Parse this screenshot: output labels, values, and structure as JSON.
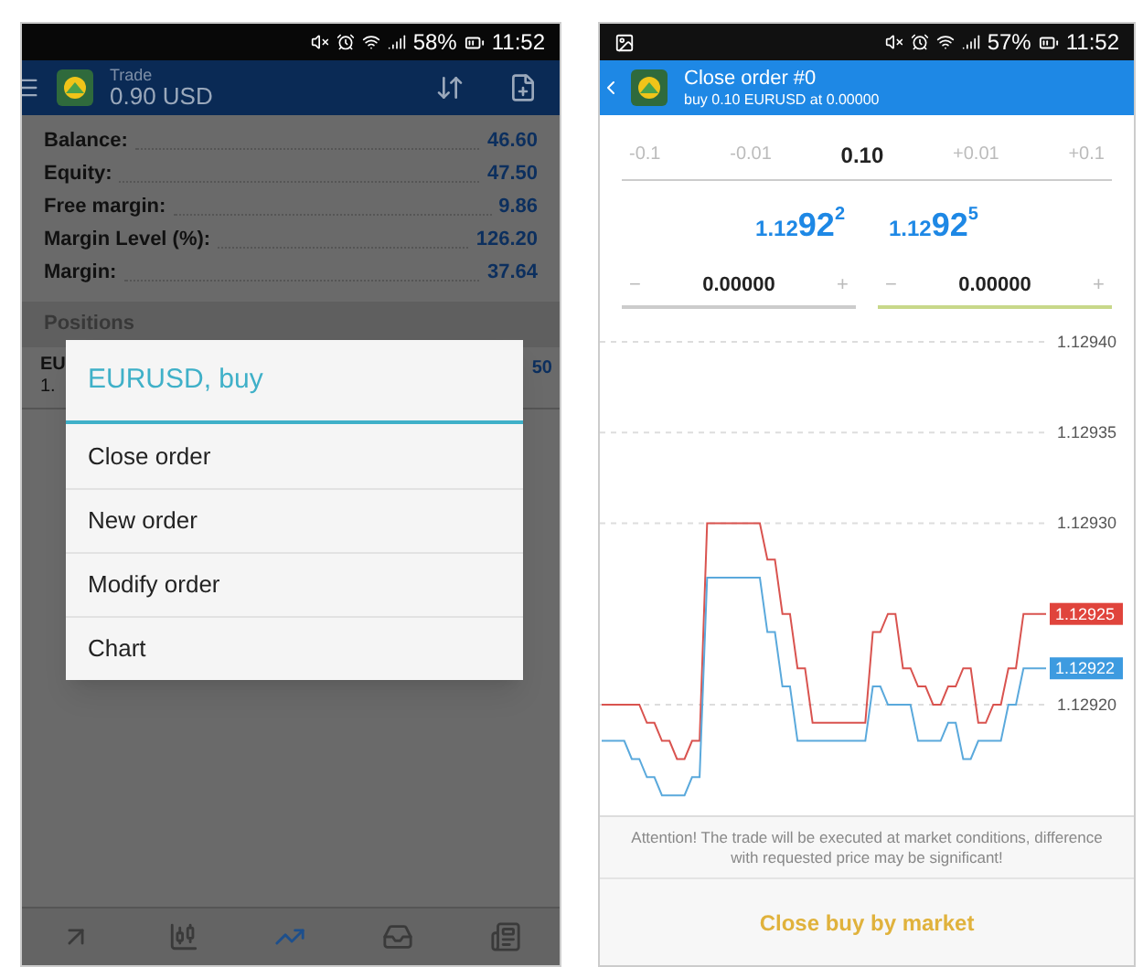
{
  "left_screen": {
    "status_bar": {
      "battery": "58%",
      "time": "11:52"
    },
    "header": {
      "title": "Trade",
      "subtitle": "0.90 USD"
    },
    "account": [
      {
        "label": "Balance:",
        "value": "46.60"
      },
      {
        "label": "Equity:",
        "value": "47.50"
      },
      {
        "label": "Free margin:",
        "value": "9.86"
      },
      {
        "label": "Margin Level (%):",
        "value": "126.20"
      },
      {
        "label": "Margin:",
        "value": "37.64"
      }
    ],
    "positions": {
      "heading": "Positions",
      "row": {
        "symbol": "EU",
        "price": "1.",
        "profit": "50"
      }
    },
    "dialog": {
      "title": "EURUSD, buy",
      "items": [
        "Close order",
        "New order",
        "Modify order",
        "Chart"
      ]
    },
    "bottom_nav": [
      {
        "kind": "trade",
        "selected": false
      },
      {
        "kind": "quotes",
        "selected": false
      },
      {
        "kind": "chart",
        "selected": true
      },
      {
        "kind": "mail",
        "selected": false
      },
      {
        "kind": "news",
        "selected": false
      }
    ]
  },
  "right_screen": {
    "status_bar": {
      "battery": "57%",
      "time": "11:52"
    },
    "header": {
      "title": "Close order #0",
      "subtitle": "buy 0.10 EURUSD at 0.00000"
    },
    "volume": {
      "steps_minus": [
        "-0.1",
        "-0.01"
      ],
      "value": "0.10",
      "steps_plus": [
        "+0.01",
        "+0.1"
      ]
    },
    "prices": [
      {
        "prefix": "1.12",
        "big": "92",
        "sup": "2"
      },
      {
        "prefix": "1.12",
        "big": "92",
        "sup": "5"
      }
    ],
    "levels": [
      {
        "minus": "−",
        "value": "0.00000",
        "plus": "+",
        "focused": false
      },
      {
        "minus": "−",
        "value": "0.00000",
        "plus": "+",
        "focused": true
      }
    ],
    "chart": {
      "chart_data": {
        "type": "line",
        "grid": true,
        "series": [
          {
            "color": "#d9534f",
            "values": [
              1.1292,
              1.1292,
              1.1292,
              1.1292,
              1.1292,
              1.1292,
              1.12919,
              1.12919,
              1.12918,
              1.12918,
              1.12917,
              1.12917,
              1.12918,
              1.12918,
              1.1293,
              1.1293,
              1.1293,
              1.1293,
              1.1293,
              1.1293,
              1.1293,
              1.1293,
              1.12928,
              1.12928,
              1.12925,
              1.12925,
              1.12922,
              1.12922,
              1.12919,
              1.12919,
              1.12919,
              1.12919,
              1.12919,
              1.12919,
              1.12919,
              1.12919,
              1.12924,
              1.12924,
              1.12925,
              1.12925,
              1.12922,
              1.12922,
              1.12921,
              1.12921,
              1.1292,
              1.1292,
              1.12921,
              1.12921,
              1.12922,
              1.12922,
              1.12919,
              1.12919,
              1.1292,
              1.1292,
              1.12922,
              1.12922,
              1.12925,
              1.12925,
              1.12925,
              1.12925
            ]
          },
          {
            "color": "#5aa9dc",
            "values": [
              1.12918,
              1.12918,
              1.12918,
              1.12918,
              1.12917,
              1.12917,
              1.12916,
              1.12916,
              1.12915,
              1.12915,
              1.12915,
              1.12915,
              1.12916,
              1.12916,
              1.12927,
              1.12927,
              1.12927,
              1.12927,
              1.12927,
              1.12927,
              1.12927,
              1.12927,
              1.12924,
              1.12924,
              1.12921,
              1.12921,
              1.12918,
              1.12918,
              1.12918,
              1.12918,
              1.12918,
              1.12918,
              1.12918,
              1.12918,
              1.12918,
              1.12918,
              1.12921,
              1.12921,
              1.1292,
              1.1292,
              1.1292,
              1.1292,
              1.12918,
              1.12918,
              1.12918,
              1.12918,
              1.12919,
              1.12919,
              1.12917,
              1.12917,
              1.12918,
              1.12918,
              1.12918,
              1.12918,
              1.1292,
              1.1292,
              1.12922,
              1.12922,
              1.12922,
              1.12922
            ]
          }
        ],
        "ylim": [
          1.12914,
          1.1294
        ],
        "yticks": [
          {
            "value": 1.1294,
            "label": "1.12940"
          },
          {
            "value": 1.12935,
            "label": "1.12935"
          },
          {
            "value": 1.1293,
            "label": "1.12930"
          },
          {
            "value": 1.1292,
            "label": "1.12920"
          }
        ]
      },
      "price_tags": [
        {
          "label": "1.12925",
          "color": "#e0443c"
        },
        {
          "label": "1.12922",
          "color": "#3d9be0"
        }
      ]
    },
    "notice": "Attention! The trade will be executed at market conditions, difference with requested price may be significant!",
    "action": "Close buy by market"
  }
}
